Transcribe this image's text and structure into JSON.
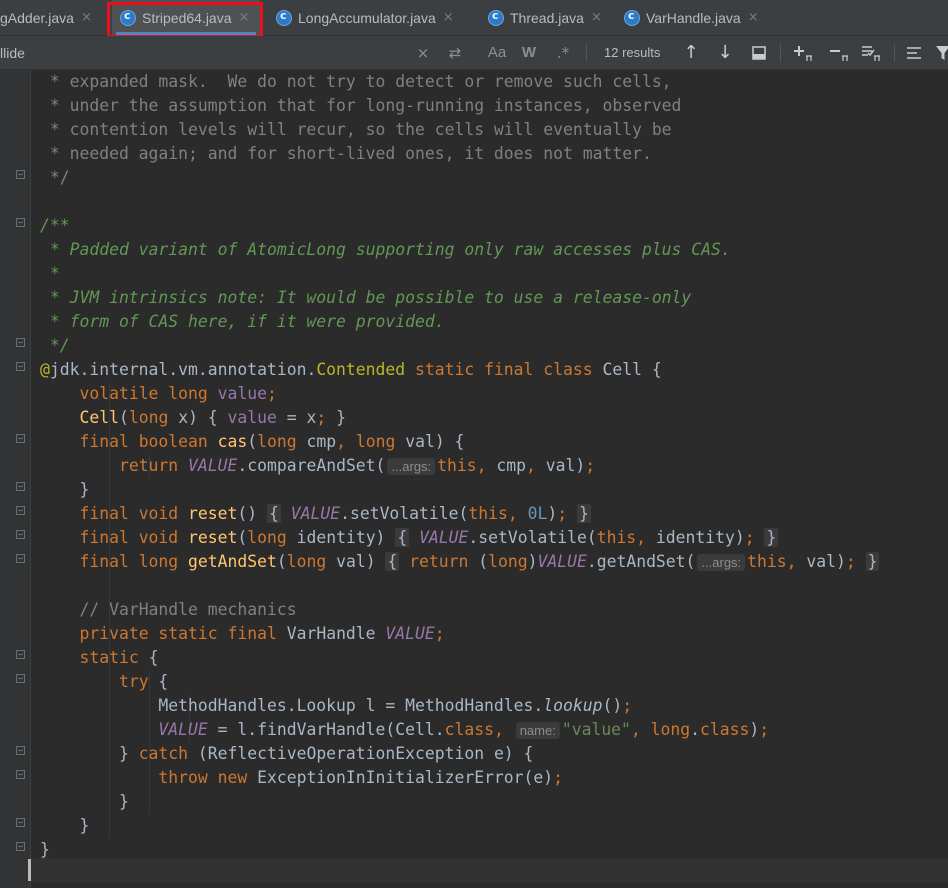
{
  "tabs": [
    {
      "label": "gAdder.java",
      "active": false,
      "has_icon": false
    },
    {
      "label": "Striped64.java",
      "active": true,
      "has_icon": true
    },
    {
      "label": "LongAccumulator.java",
      "active": false,
      "has_icon": true
    },
    {
      "label": "Thread.java",
      "active": false,
      "has_icon": true
    },
    {
      "label": "VarHandle.java",
      "active": false,
      "has_icon": true
    }
  ],
  "tab_close_glyph": "×",
  "find": {
    "query": "llide",
    "results": "12 results",
    "case_label": "Aa",
    "word_label": "W",
    "regex_label": ".*",
    "clear_glyph": "×",
    "replace_glyph": "⇄",
    "up_glyph": "↑",
    "down_glyph": "↓"
  },
  "hints": {
    "args": "...args:",
    "name": "name:"
  },
  "code": {
    "l1": " * expanded mask.  We do not try to detect or remove such cells,",
    "l2": " * under the assumption that for long-running instances, observed",
    "l3": " * contention levels will recur, so the cells will eventually be",
    "l4": " * needed again; and for short-lived ones, it does not matter.",
    "l5": " */",
    "l7": "/**",
    "l8": " * Padded variant of AtomicLong supporting only raw accesses plus CAS.",
    "l9": " *",
    "l10": " * JVM intrinsics note: It would be possible to use a release-only",
    "l11": " * form of CAS here, if it were provided.",
    "l12": " */",
    "comment_varhandle": "// VarHandle mechanics"
  },
  "colors": {
    "background": "#2b2b2b",
    "keyword": "#cc7832",
    "doc_comment": "#629755",
    "annotation": "#bbb529",
    "field": "#9876aa",
    "method": "#ffc66d",
    "highlight_box": "#e8101a"
  }
}
